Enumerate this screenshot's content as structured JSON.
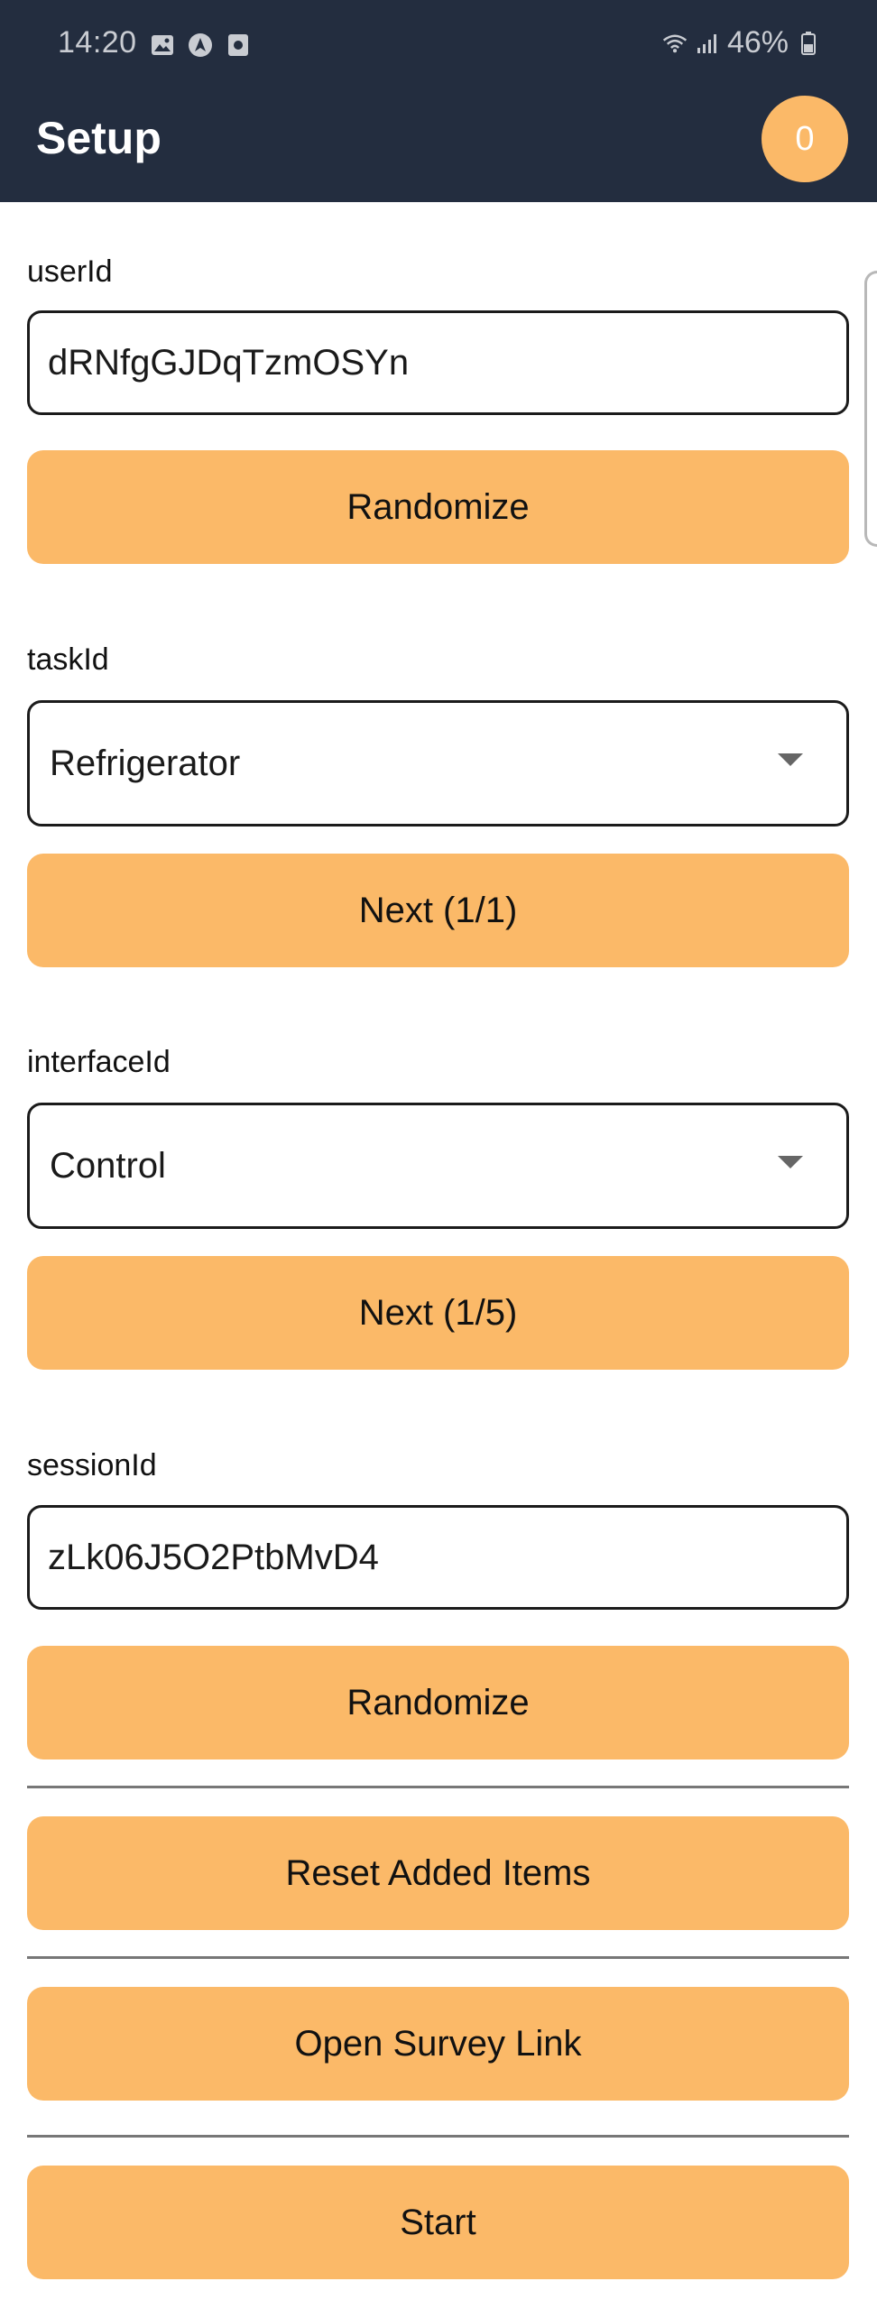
{
  "status_bar": {
    "time": "14:20",
    "battery": "46%",
    "icons": [
      "gallery-icon",
      "navigation-icon",
      "screen-record-icon",
      "wifi-icon",
      "signal-icon",
      "battery-icon"
    ]
  },
  "app_bar": {
    "title": "Setup",
    "badge_count": "0"
  },
  "colors": {
    "app_bar_bg": "#232d3f",
    "accent": "#fbb968",
    "border": "#1b1b1b",
    "divider": "#777777"
  },
  "form": {
    "user": {
      "label": "userId",
      "value": "dRNfgGJDqTzmOSYn",
      "button": "Randomize"
    },
    "task": {
      "label": "taskId",
      "selected": "Refrigerator",
      "button": "Next (1/1)"
    },
    "interface": {
      "label": "interfaceId",
      "selected": "Control",
      "button": "Next (1/5)"
    },
    "session": {
      "label": "sessionId",
      "value": "zLk06J5O2PtbMvD4",
      "button": "Randomize"
    }
  },
  "actions": {
    "reset": "Reset Added Items",
    "survey": "Open Survey Link",
    "start": "Start"
  }
}
